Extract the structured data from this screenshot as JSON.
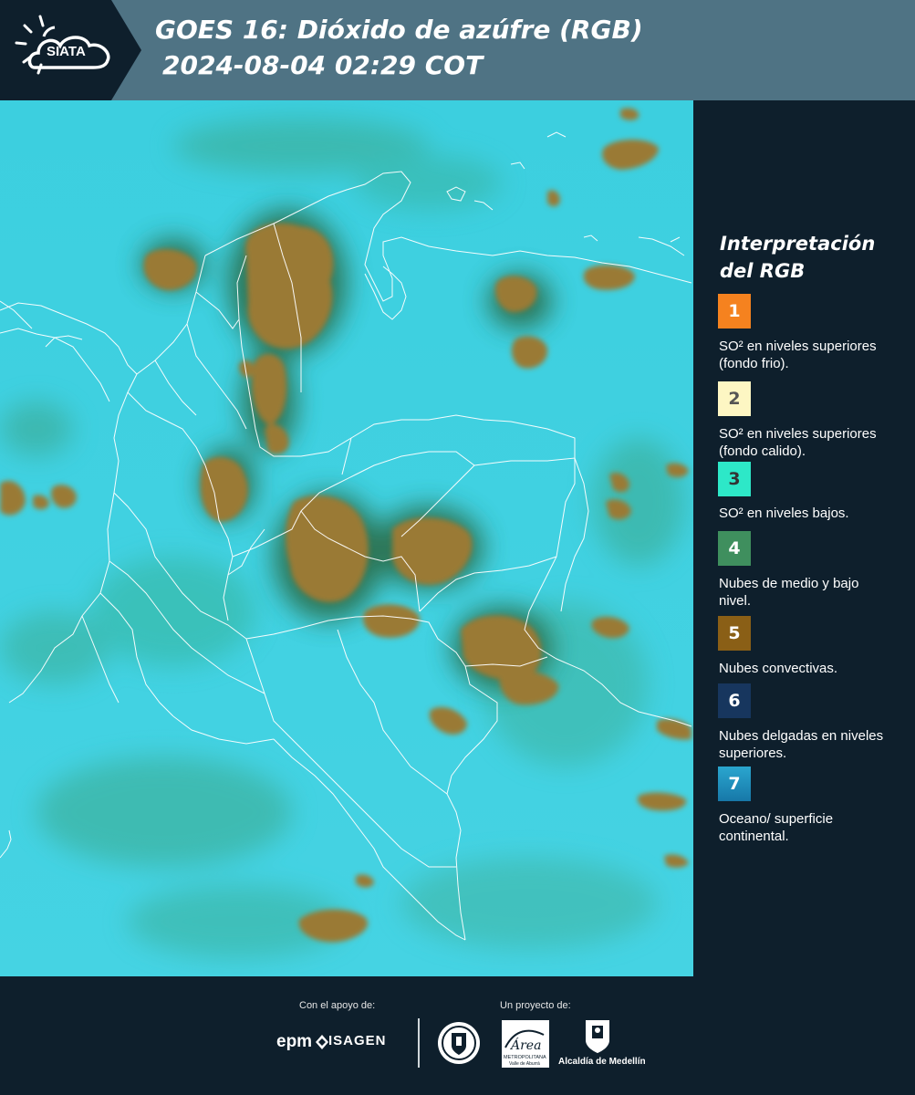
{
  "header": {
    "logo_text": "SIATA",
    "title_line1": "GOES 16: Dióxido de azúfre (RGB)",
    "title_line2": "2024-08-04 02:29 COT"
  },
  "legend": {
    "title": "Interpretación del RGB",
    "items": [
      {
        "number": "1",
        "text": "SO² en niveles superiores (fondo frio).",
        "color": "#f5821f",
        "text_color": "#ffffff"
      },
      {
        "number": "2",
        "text": "SO² en niveles superiores (fondo calido).",
        "color": "#fdf6c3",
        "text_color": "#555555"
      },
      {
        "number": "3",
        "text": "SO² en niveles bajos.",
        "color": "#2de8c8",
        "text_color": "#333333"
      },
      {
        "number": "4",
        "text": "Nubes de medio y bajo nivel.",
        "color": "#3f8f5e",
        "text_color": "#ffffff"
      },
      {
        "number": "5",
        "text": "Nubes convectivas.",
        "color": "#8a5f16",
        "text_color": "#ffffff"
      },
      {
        "number": "6",
        "text": "Nubes delgadas en niveles superiores.",
        "color": "#17365e",
        "text_color": "#ffffff"
      },
      {
        "number": "7",
        "text": "Oceano/ superficie continental.",
        "color": "#1d8fbd",
        "text_color": "#ffffff"
      }
    ]
  },
  "footer": {
    "support_label": "Con el apoyo de:",
    "project_label": "Un proyecto de:",
    "sponsors": [
      "epm",
      "ISAGEN"
    ],
    "area_logo_text": "Área",
    "area_logo_subtext": "METROPOLITANA",
    "area_logo_subtext2": "Valle de Aburrá",
    "alcaldia": "Alcaldía de Medellín"
  },
  "colors": {
    "header_bg": "#4f7384",
    "background": "#0e1f2c",
    "map_cyan": "#3fd0e0",
    "cloud_brown": "#9a7a35",
    "border_lines": "#ffffff"
  }
}
